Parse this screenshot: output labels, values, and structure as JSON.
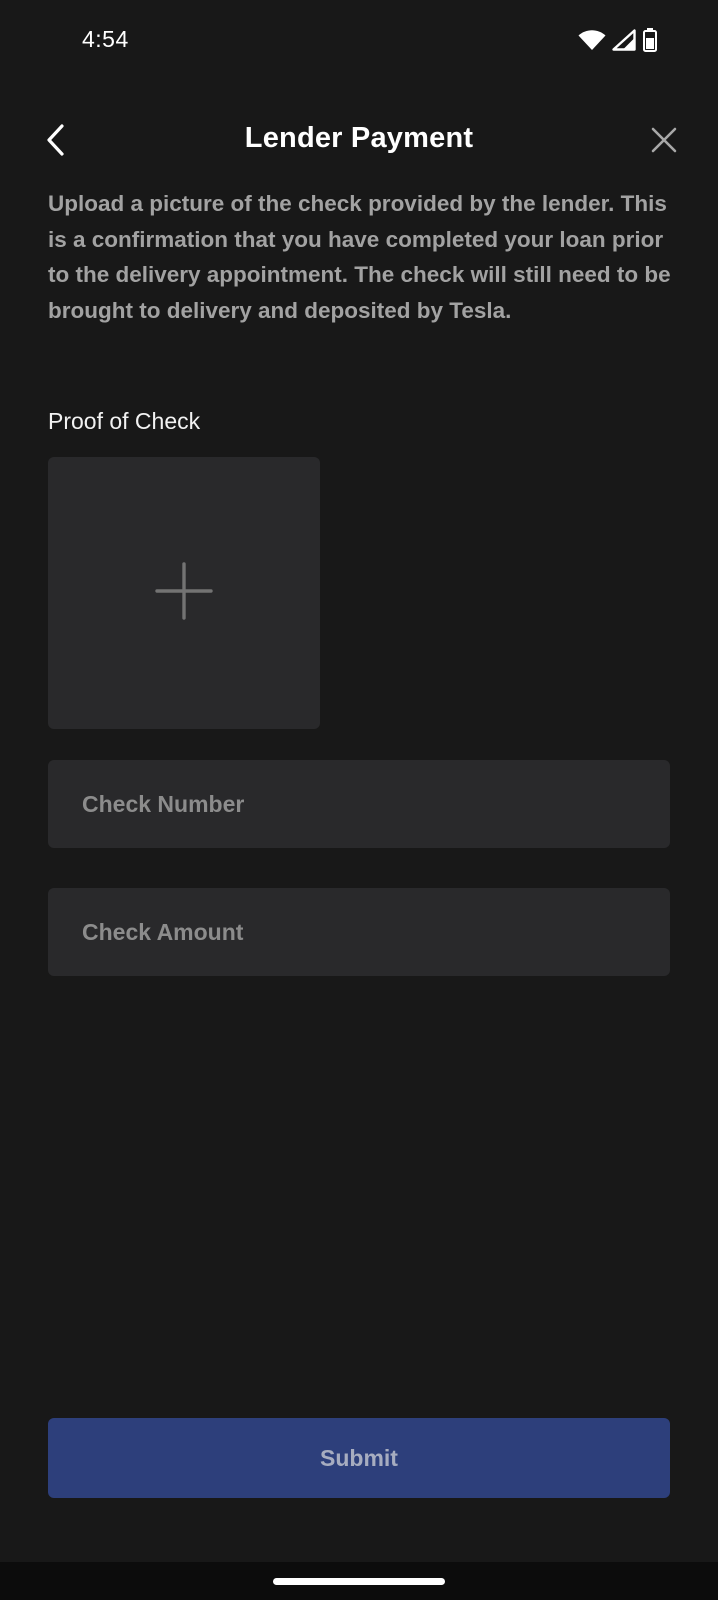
{
  "status_bar": {
    "time": "4:54",
    "icons": [
      "wifi-icon",
      "cellular-signal-icon",
      "battery-icon"
    ]
  },
  "header": {
    "title": "Lender Payment",
    "back_icon": "chevron-left-icon",
    "close_icon": "close-icon"
  },
  "description": "Upload a picture of the check provided by the lender. This is a confirmation that you have completed your loan prior to the delivery appointment. The check will still need to be brought to delivery and deposited by Tesla.",
  "proof": {
    "label": "Proof of Check",
    "upload_icon": "plus-icon"
  },
  "fields": {
    "check_number": {
      "value": "",
      "placeholder": "Check Number"
    },
    "check_amount": {
      "value": "",
      "placeholder": "Check Amount"
    }
  },
  "submit": {
    "label": "Submit",
    "color": "#2d3f7b"
  },
  "colors": {
    "background": "#181818",
    "surface": "#29292b",
    "text_primary": "#ffffff",
    "text_secondary": "#a2a2a2"
  }
}
